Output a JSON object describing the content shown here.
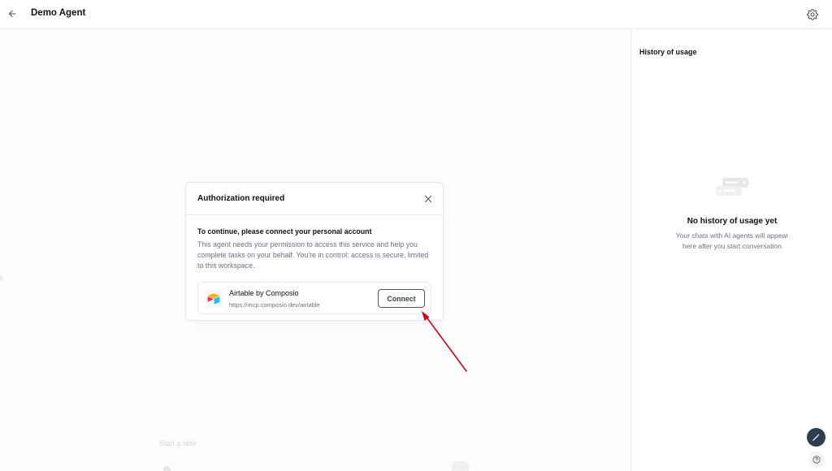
{
  "header": {
    "title": "Demo Agent",
    "back_icon": "arrow-left-icon",
    "settings_icon": "gear-icon"
  },
  "main": {
    "placeholder_text": "Start a task"
  },
  "modal": {
    "title": "Authorization required",
    "subtitle": "To continue, please connect your personal account",
    "description": "This agent needs your permission to access this service and help you complete tasks on your behalf. You're in control: access is secure, limited to this workspace.",
    "service": {
      "name": "Airtable by Composio",
      "url": "https://mcp.composio.dev/airtable",
      "connect_label": "Connect"
    }
  },
  "sidebar": {
    "title": "History of usage",
    "empty_title": "No history of usage yet",
    "empty_description": "Your chats with AI agents will appear here after you start conversation"
  },
  "colors": {
    "accent_arrow": "#d0021b",
    "fab_background": "#2f3d4f",
    "border": "#ececec"
  }
}
